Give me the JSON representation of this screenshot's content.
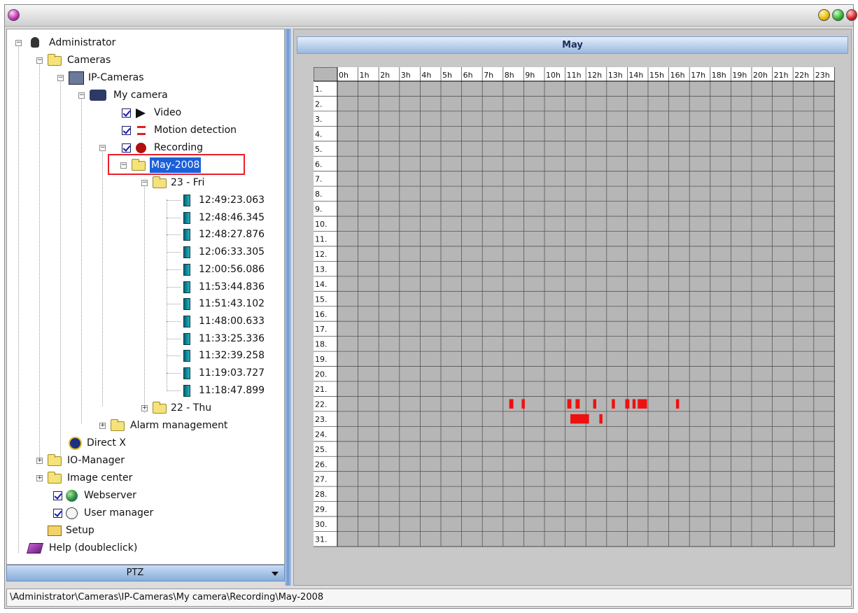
{
  "colors": {
    "accent": "#1b5fd8",
    "recording_mark": "#ee1111",
    "highlight_box": "#e8202a"
  },
  "tree": {
    "administrator": "Administrator",
    "cameras": "Cameras",
    "ip_cameras": "IP-Cameras",
    "my_camera": "My camera",
    "video": "Video",
    "motion_detection": "Motion detection",
    "recording": "Recording",
    "month": "May-2008",
    "day_fri": "23 - Fri",
    "recordings": [
      "12:49:23.063",
      "12:48:46.345",
      "12:48:27.876",
      "12:06:33.305",
      "12:00:56.086",
      "11:53:44.836",
      "11:51:43.102",
      "11:48:00.633",
      "11:33:25.336",
      "11:32:39.258",
      "11:19:03.727",
      "11:18:47.899"
    ],
    "day_thu": "22 - Thu",
    "alarm_management": "Alarm management",
    "direct_x": "Direct X",
    "io_manager": "IO-Manager",
    "image_center": "Image center",
    "webserver": "Webserver",
    "user_manager": "User manager",
    "setup": "Setup",
    "help": "Help (doubleclick)"
  },
  "icons": {
    "administrator": "user-icon",
    "cameras": "folder-icon",
    "ip_cameras": "network-camera-icon",
    "my_camera": "camera-icon",
    "video": "play-icon",
    "motion_detection": "motion-icon",
    "recording": "record-icon",
    "recording_file": "file-icon",
    "direct_x": "directx-icon",
    "webserver": "globe-icon",
    "user_manager": "users-icon",
    "setup": "setup-icon",
    "help": "help-book-icon"
  },
  "ptz": {
    "label": "PTZ"
  },
  "calendar": {
    "title": "May",
    "hours": [
      "0h",
      "1h",
      "2h",
      "3h",
      "4h",
      "5h",
      "6h",
      "7h",
      "8h",
      "9h",
      "10h",
      "11h",
      "12h",
      "13h",
      "14h",
      "15h",
      "16h",
      "17h",
      "18h",
      "19h",
      "20h",
      "21h",
      "22h",
      "23h"
    ],
    "days": [
      "1.",
      "2.",
      "3.",
      "4.",
      "5.",
      "6.",
      "7.",
      "8.",
      "9.",
      "10.",
      "11.",
      "12.",
      "13.",
      "14.",
      "15.",
      "16.",
      "17.",
      "18.",
      "19.",
      "20.",
      "21.",
      "22.",
      "23.",
      "24.",
      "25.",
      "26.",
      "27.",
      "28.",
      "29.",
      "30.",
      "31."
    ],
    "marks": [
      {
        "day": 22,
        "start": 8.3,
        "end": 8.5
      },
      {
        "day": 22,
        "start": 8.9,
        "end": 9.05
      },
      {
        "day": 22,
        "start": 11.1,
        "end": 11.3
      },
      {
        "day": 22,
        "start": 11.5,
        "end": 11.7
      },
      {
        "day": 22,
        "start": 12.35,
        "end": 12.5
      },
      {
        "day": 22,
        "start": 13.25,
        "end": 13.4
      },
      {
        "day": 22,
        "start": 13.9,
        "end": 14.1
      },
      {
        "day": 22,
        "start": 14.25,
        "end": 14.4
      },
      {
        "day": 22,
        "start": 14.5,
        "end": 14.95
      },
      {
        "day": 22,
        "start": 16.35,
        "end": 16.5
      },
      {
        "day": 23,
        "start": 11.25,
        "end": 12.15
      },
      {
        "day": 23,
        "start": 12.65,
        "end": 12.8
      }
    ]
  },
  "status": {
    "path": "\\Administrator\\Cameras\\IP-Cameras\\My camera\\Recording\\May-2008"
  }
}
